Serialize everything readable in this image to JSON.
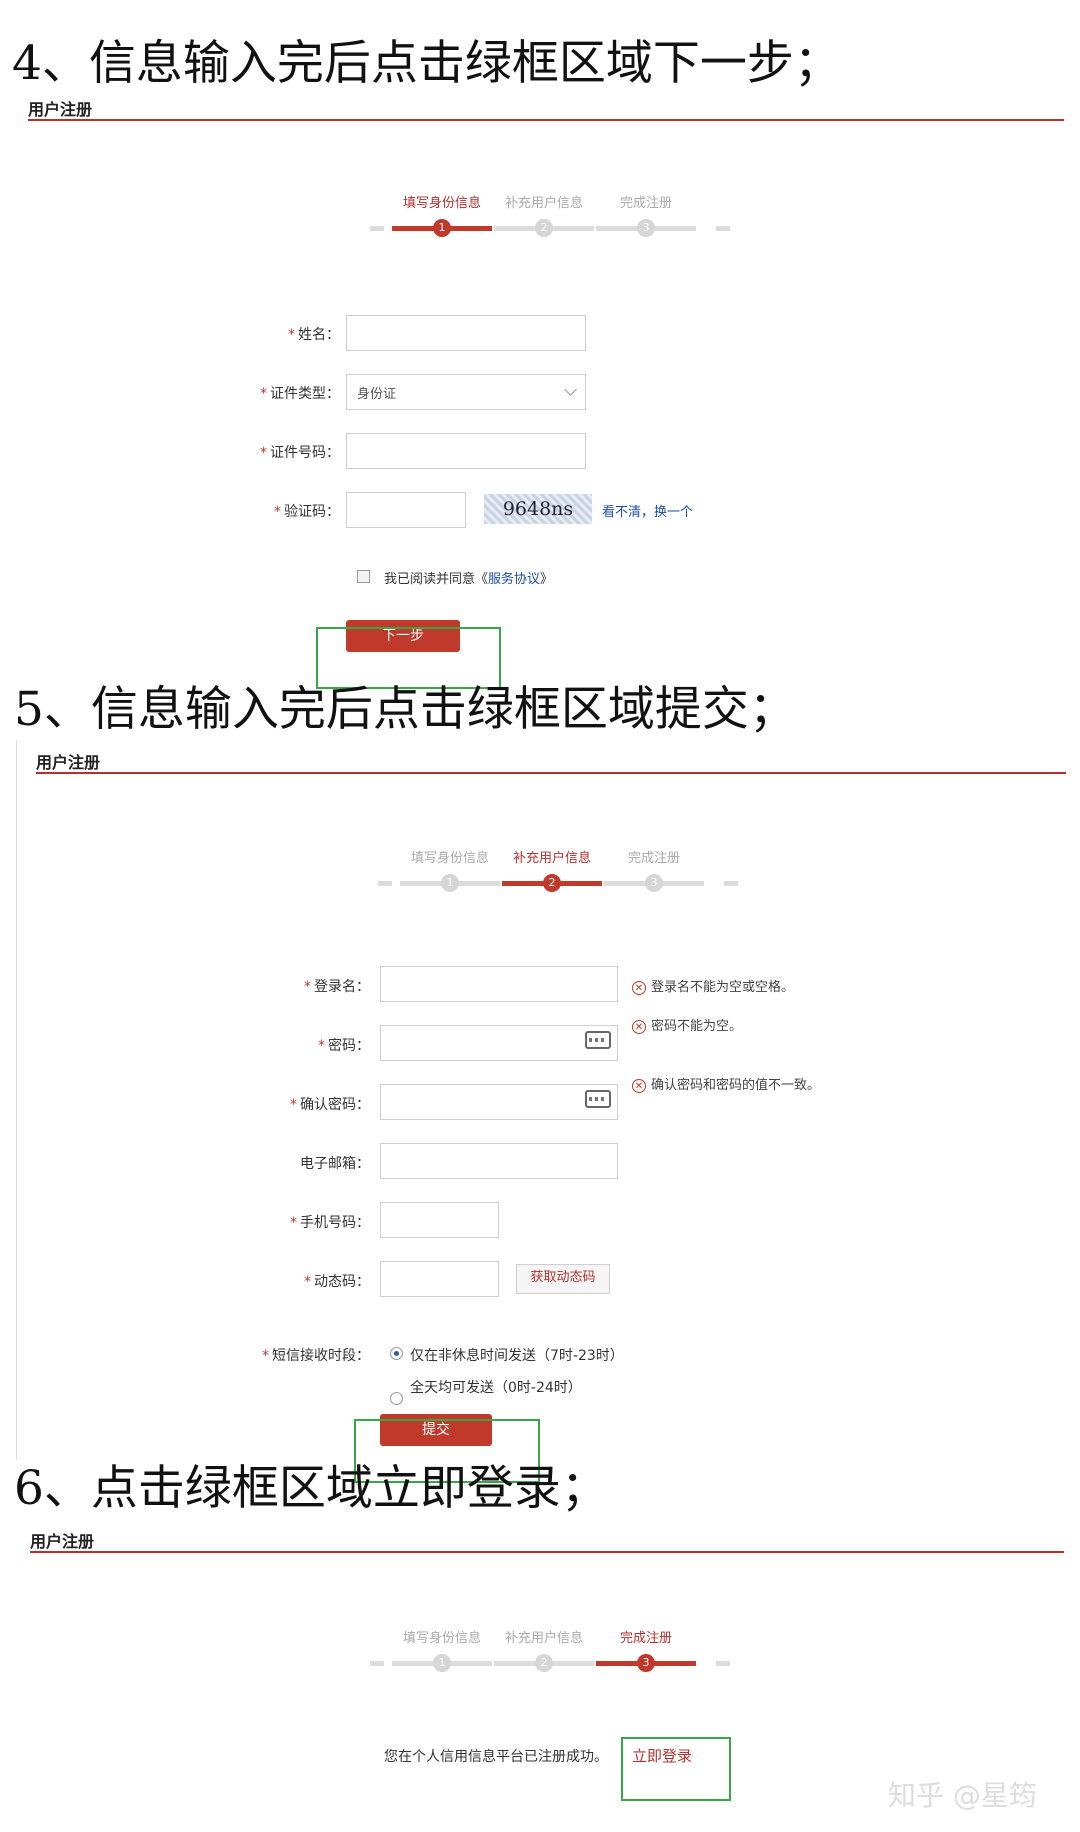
{
  "section4": {
    "heading": "4、信息输入完后点击绿框区域下一步；",
    "panel_title": "用户注册",
    "steps": [
      {
        "label": "填写身份信息",
        "num": "1",
        "active": true
      },
      {
        "label": "补充用户信息",
        "num": "2",
        "active": false
      },
      {
        "label": "完成注册",
        "num": "3",
        "active": false
      }
    ],
    "fields": {
      "required_mark": "*",
      "name_label": "姓名：",
      "id_type_label": "证件类型：",
      "id_type_value": "身份证",
      "id_number_label": "证件号码：",
      "captcha_label": "验证码："
    },
    "captcha_image_text": "9648ns",
    "captcha_refresh": "看不清，换一个",
    "agreement_text": "我已阅读并同意《",
    "agreement_link": "服务协议",
    "agreement_close": "》",
    "next_button": "下一步"
  },
  "section5": {
    "heading": "5、信息输入完后点击绿框区域提交；",
    "panel_title": "用户注册",
    "steps": [
      {
        "label": "填写身份信息",
        "num": "1",
        "active": false
      },
      {
        "label": "补充用户信息",
        "num": "2",
        "active": true
      },
      {
        "label": "完成注册",
        "num": "3",
        "active": false
      }
    ],
    "fields": {
      "required_mark": "*",
      "login_label": "登录名：",
      "password_label": "密码：",
      "confirm_label": "确认密码：",
      "email_label": "电子邮箱：",
      "phone_label": "手机号码：",
      "code_label": "动态码：",
      "sms_label": "短信接收时段："
    },
    "errors": {
      "login": "登录名不能为空或空格。",
      "password": "密码不能为空。",
      "confirm": "确认密码和密码的值不一致。"
    },
    "error_icon": "x-circle-icon",
    "get_code_button": "获取动态码",
    "sms_options": [
      {
        "label": "仅在非休息时间发送（7时-23时）",
        "selected": true
      },
      {
        "label": "全天均可发送（0时-24时）",
        "selected": false
      }
    ],
    "submit_button": "提交"
  },
  "section6": {
    "heading": "6、点击绿框区域立即登录；",
    "panel_title": "用户注册",
    "steps": [
      {
        "label": "填写身份信息",
        "num": "1",
        "active": false
      },
      {
        "label": "补充用户信息",
        "num": "2",
        "active": false
      },
      {
        "label": "完成注册",
        "num": "3",
        "active": true
      }
    ],
    "success_text": "您在个人信用信息平台已注册成功。",
    "login_link": "立即登录"
  },
  "watermark": "知乎 @星筠",
  "colors": {
    "accent": "#c0392b",
    "highlight_box": "#3aa745",
    "link": "#1d4fa1"
  }
}
